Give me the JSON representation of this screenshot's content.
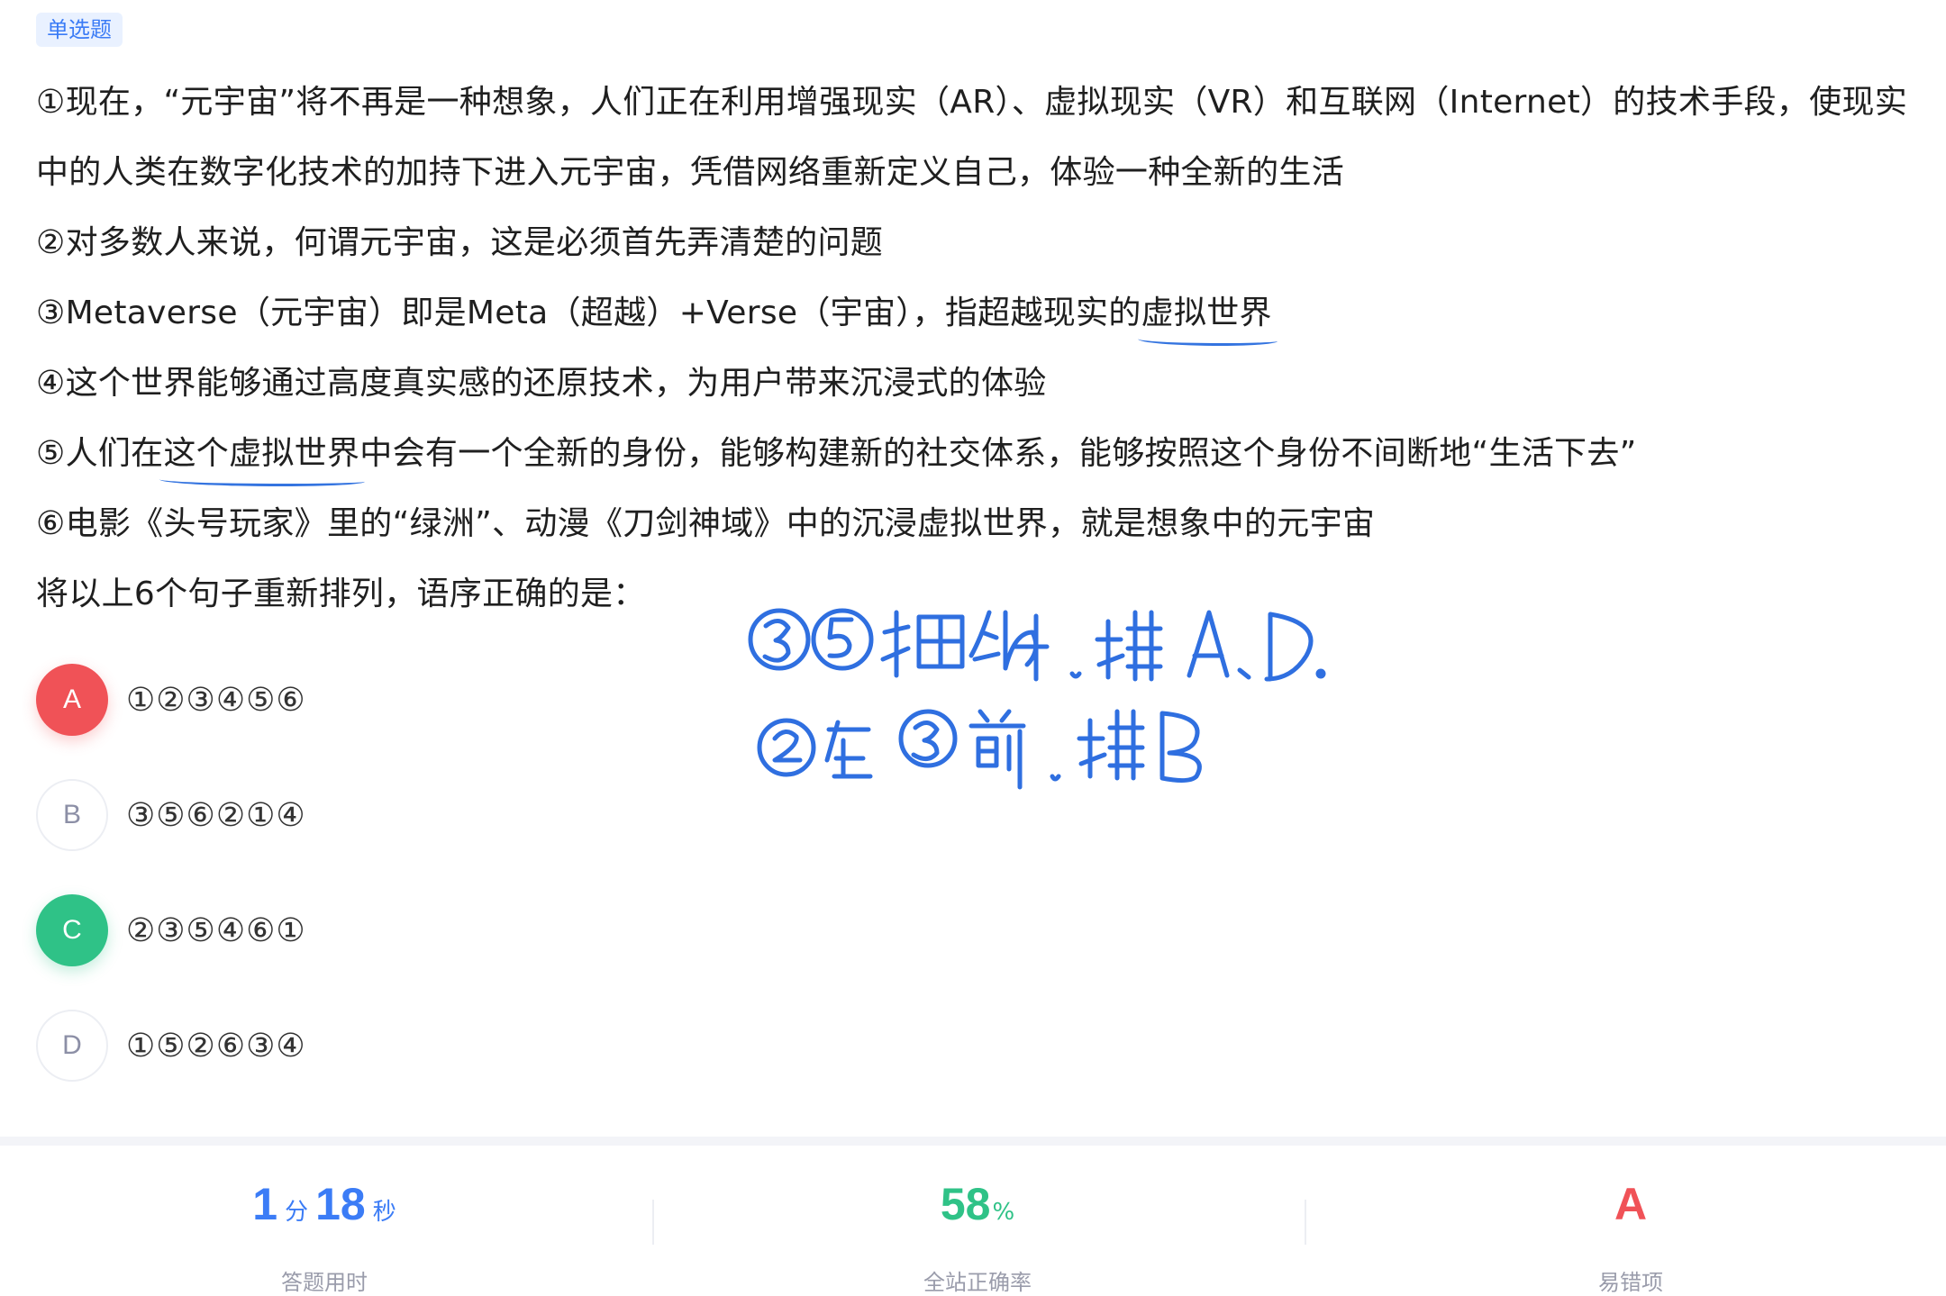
{
  "question_type": "单选题",
  "question": {
    "s1a": "①现在，“元宇宙”将不再是一种想象，人们正在利用增强现实（AR）、虚拟现实（VR）和互联网（Internet）的技术手段，使现实",
    "s1b": "中的人类在数字化技术的加持下进入元宇宙，凭借网络重新定义自己，体验一种全新的生活",
    "s2": "②对多数人来说，何谓元宇宙，这是必须首先弄清楚的问题",
    "s3_pre": "③Metaverse（元宇宙）即是Meta（超越）+Verse（宇宙），指超越现实的",
    "s3_ul": "虚拟世界",
    "s4": "④这个世界能够通过高度真实感的还原技术，为用户带来沉浸式的体验",
    "s5_pre": "⑤人们在",
    "s5_ul": "这个虚拟世界",
    "s5_post": "中会有一个全新的身份，能够构建新的社交体系，能够按照这个身份不间断地“生活下去”",
    "s6": "⑥电影《头号玩家》里的“绿洲”、动漫《刀剑神域》中的沉浸虚拟世界，就是想象中的元宇宙",
    "prompt": "将以上6个句子重新排列，语序正确的是："
  },
  "options": [
    {
      "letter": "A",
      "text": "①②③④⑤⑥",
      "state": "wrong"
    },
    {
      "letter": "B",
      "text": "③⑤⑥②①④",
      "state": "none"
    },
    {
      "letter": "C",
      "text": "②③⑤④⑥①",
      "state": "correct"
    },
    {
      "letter": "D",
      "text": "①⑤②⑥③④",
      "state": "none"
    }
  ],
  "handwritten_notes": [
    "③⑤捆绑，排A、D.",
    "②在③前，排B"
  ],
  "stats": {
    "time_min": "1",
    "time_min_unit": "分",
    "time_sec": "18",
    "time_sec_unit": "秒",
    "time_label": "答题用时",
    "accuracy": "58",
    "accuracy_unit": "%",
    "accuracy_label": "全站正确率",
    "common_wrong": "A",
    "common_wrong_label": "易错项"
  },
  "colors": {
    "wrong": "#f05257",
    "correct": "#2fc287",
    "accent": "#3b7cf6",
    "ink": "#2f6fe0"
  }
}
